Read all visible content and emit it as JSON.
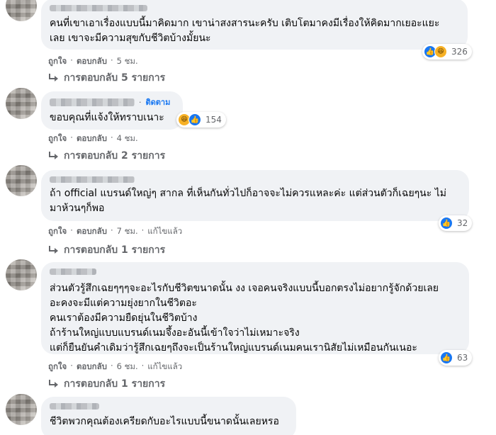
{
  "comments": [
    {
      "lines": [
        "คนที่เขาเอาเรื่องแบบนี้มาคิดมาก เขาน่าสงสารนะครับ เติบโตมาคงมีเรื่องให้คิดมากเยอะแยะ",
        "เลย เขาจะมีความสุขกับชีวิตบ้างมั้ยนะ"
      ],
      "like": "ถูกใจ",
      "reply": "ตอบกลับ",
      "time": "5 ชม.",
      "reaction_count": "326",
      "replies": "การตอบกลับ 5 รายการ"
    },
    {
      "follow": "ติดตาม",
      "lines": [
        "ขอบคุณที่แจ้งให้ทราบเนาะ"
      ],
      "like": "ถูกใจ",
      "reply": "ตอบกลับ",
      "time": "4 ชม.",
      "reaction_count": "154",
      "replies": "การตอบกลับ 2 รายการ"
    },
    {
      "lines": [
        "ถ้า official แบรนด์ใหญ่ๆ สากล ที่เห็นกันทั่วไปก็อาจจะไม่ควรแหละค่ะ แต่ส่วนตัวก็เฉยๆนะ ไม่",
        "มาห้วนๆก็พอ"
      ],
      "like": "ถูกใจ",
      "reply": "ตอบกลับ",
      "time": "7 ชม.",
      "edited": "แก้ไขแล้ว",
      "reaction_count": "32",
      "replies": "การตอบกลับ 1 รายการ"
    },
    {
      "lines": [
        "ส่วนตัวรู้สึกเฉยๆๆๆจะอะไรกับชีวิตขนาดนั้น งง เจอคนจริงแบบนี้บอกตรงไม่อยากรู้จักด้วยเลย",
        "อะคงจะมีแต่ความยุ่งยากในชีวิตอะ",
        "คนเราต้องมีความยืดยุ่นในชีวิตบ้าง",
        "ถ้าร้านใหญ่แบบแบรนด์เนมจึ้งอะอันนี้เข้าใจว่าไม่เหมาะจริง",
        "แต่ก็ยืนยันคำเดิมว่ารู้สึกเฉยๆถึงจะเป็นร้านใหญ่แบรนด์เนมคนเรานิสัยไม่เหมือนกันเนอะ"
      ],
      "like": "ถูกใจ",
      "reply": "ตอบกลับ",
      "time": "6 ชม.",
      "edited": "แก้ไขแล้ว",
      "reaction_count": "63",
      "replies": "การตอบกลับ 1 รายการ"
    },
    {
      "lines": [
        "ชีวิตพวกคุณต้องเครียดกับอะไรแบบนี้ขนาดนั้นเลยหรอ"
      ]
    }
  ],
  "separator": "·",
  "colors": {
    "bubble": "#f0f2f5",
    "meta": "#65676b",
    "link": "#1877f2"
  }
}
